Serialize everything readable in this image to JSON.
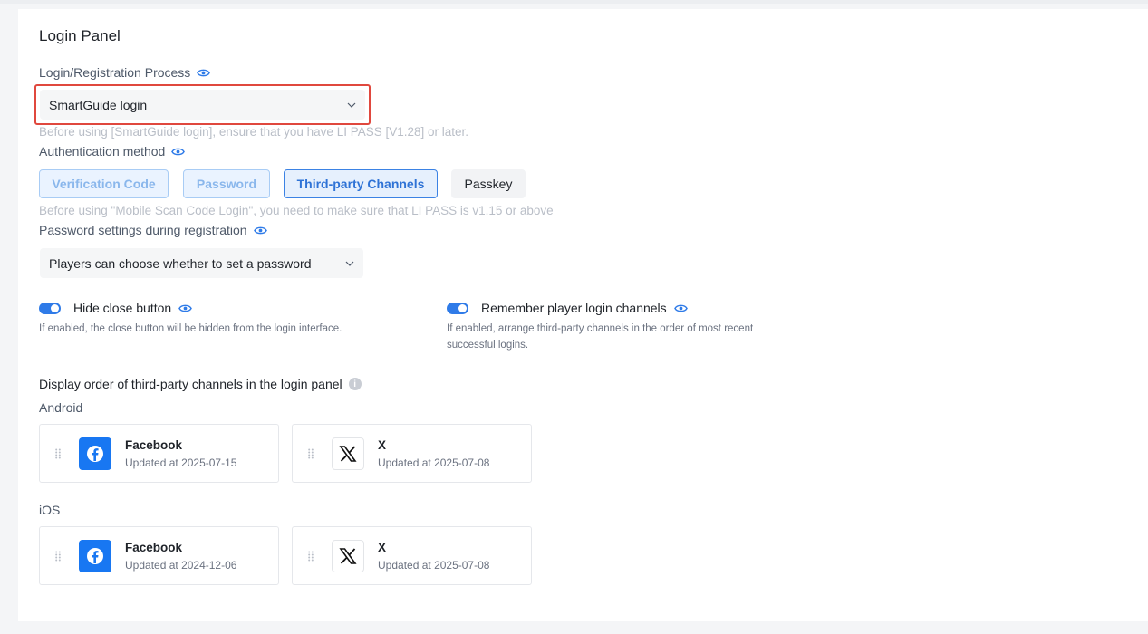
{
  "panel": {
    "title": "Login Panel"
  },
  "process": {
    "label": "Login/Registration Process",
    "selected": "SmartGuide login",
    "hint": "Before using [SmartGuide login], ensure that you have LI PASS [V1.28] or later."
  },
  "auth": {
    "label": "Authentication method",
    "methods": [
      {
        "label": "Verification Code",
        "state": "disabled-selected"
      },
      {
        "label": "Password",
        "state": "disabled-selected"
      },
      {
        "label": "Third-party Channels",
        "state": "selected"
      },
      {
        "label": "Passkey",
        "state": "unselected"
      }
    ],
    "hint": "Before using \"Mobile Scan Code Login\", you need to make sure that LI PASS is v1.15 or above"
  },
  "password_settings": {
    "label": "Password settings during registration",
    "selected": "Players can choose whether to set a password"
  },
  "toggles": {
    "hide_close": {
      "label": "Hide close button",
      "enabled": true,
      "description": "If enabled, the close button will be hidden from the login interface."
    },
    "remember_channels": {
      "label": "Remember player login channels",
      "enabled": true,
      "description_line1": "If enabled, arrange third-party channels in the order of most recent",
      "description_line2": "successful logins."
    }
  },
  "channels": {
    "label": "Display order of third-party channels in the login panel",
    "updated_prefix": "Updated at",
    "android": {
      "label": "Android",
      "items": [
        {
          "name": "Facebook",
          "date": "2025-07-15",
          "icon": "facebook-icon"
        },
        {
          "name": "X",
          "date": "2025-07-08",
          "icon": "x-logo-icon"
        }
      ]
    },
    "ios": {
      "label": "iOS",
      "items": [
        {
          "name": "Facebook",
          "date": "2024-12-06",
          "icon": "facebook-icon"
        },
        {
          "name": "X",
          "date": "2025-07-08",
          "icon": "x-logo-icon"
        }
      ]
    }
  },
  "colors": {
    "accent": "#2f7be8",
    "highlight_border": "#e0483e",
    "facebook": "#1877f2"
  }
}
